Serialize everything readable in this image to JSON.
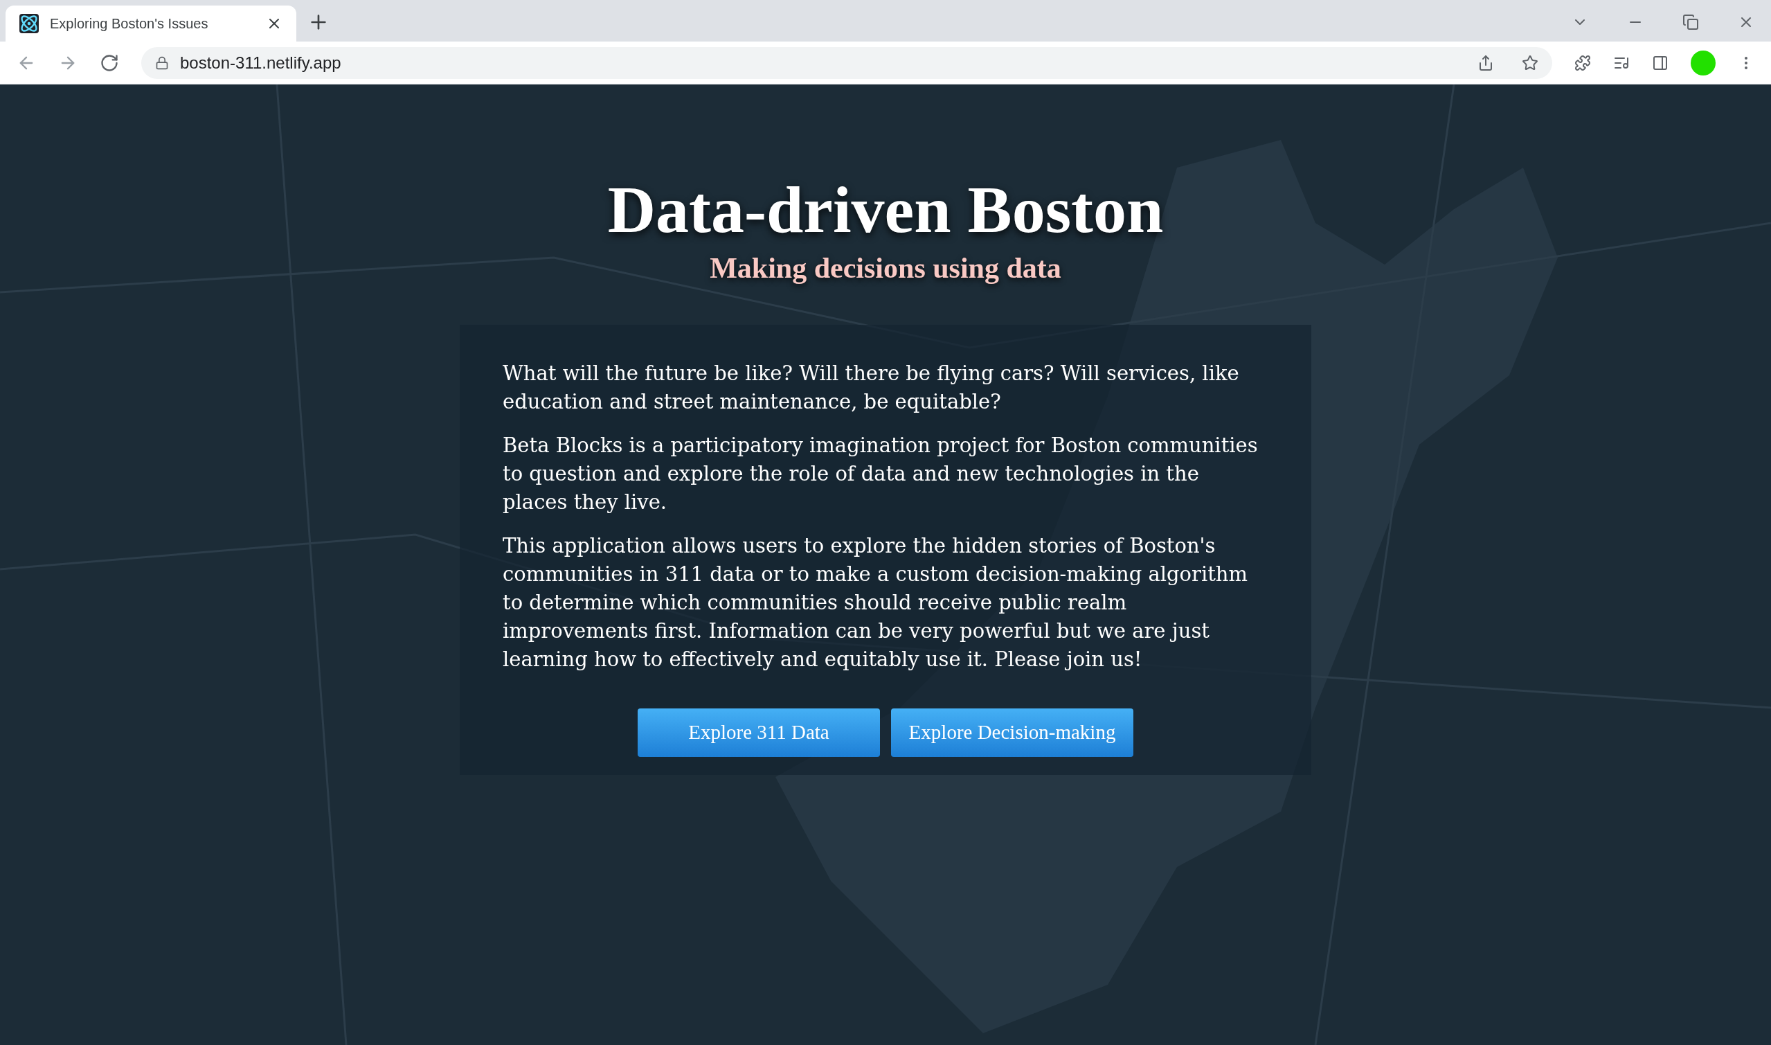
{
  "browser": {
    "tab": {
      "title": "Exploring Boston's Issues",
      "selected": true
    },
    "url": "boston-311.netlify.app"
  },
  "hero": {
    "title": "Data-driven Boston",
    "subtitle": "Making decisions using data"
  },
  "paragraphs": [
    "What will the future be like? Will there be flying cars? Will services, like education and street maintenance, be equitable?",
    "Beta Blocks is a participatory imagination project for Boston communities to question and explore the role of data and new technologies in the places they live.",
    "This application allows users to explore the hidden stories of Boston's communities in 311 data or to make a custom decision-making algorithm to determine which communities should receive public realm improvements first. Information can be very powerful but we are just learning how to effectively and equitably use it. Please join us!"
  ],
  "buttons": [
    "Explore 311 Data",
    "Explore Decision-making"
  ]
}
